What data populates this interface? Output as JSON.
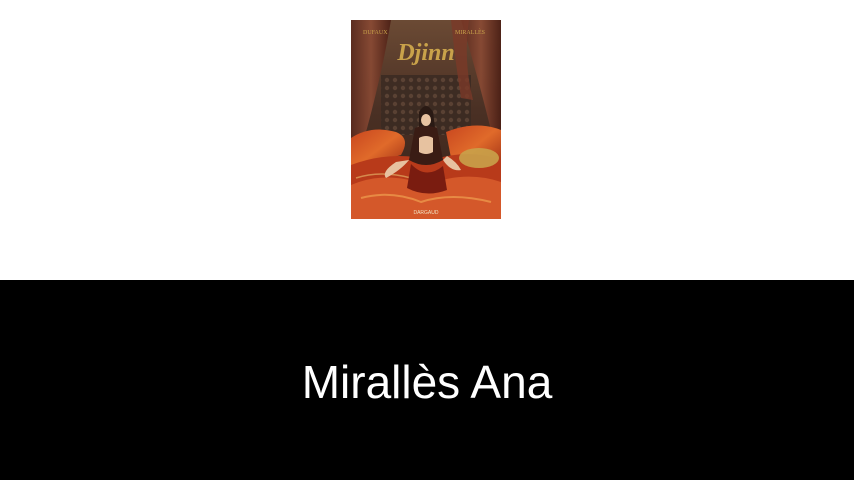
{
  "cover": {
    "title": "Djinn",
    "author_left": "DUFAUX",
    "author_right": "MIRALLÈS",
    "publisher": "DARGAUD",
    "subtitle": ""
  },
  "caption": {
    "text": "Mirallès Ana"
  },
  "colors": {
    "background": "#ffffff",
    "band": "#000000",
    "caption_text": "#ffffff",
    "cover_gold": "#c9a24a",
    "cover_red": "#b8351c"
  }
}
